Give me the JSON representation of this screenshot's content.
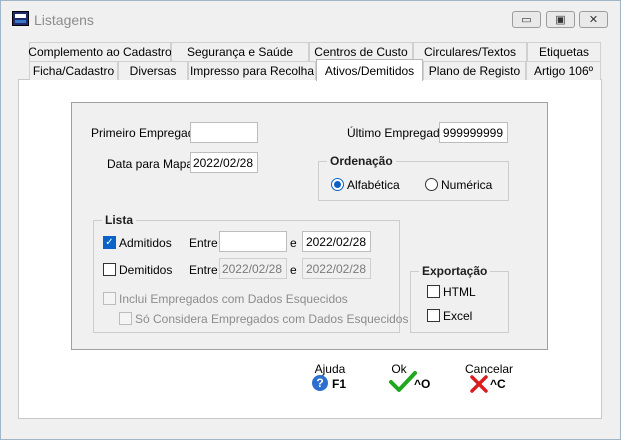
{
  "window": {
    "title": "Listagens",
    "minimize_glyph": "▭",
    "maximize_glyph": "▣",
    "close_glyph": "✕"
  },
  "tabs_row1": [
    "Complemento ao Cadastro",
    "Segurança e Saúde",
    "Centros de Custo",
    "Circulares/Textos",
    "Etiquetas"
  ],
  "tabs_row2": [
    "Ficha/Cadastro",
    "Diversas",
    "Impresso para Recolha",
    "Ativos/Demitidos",
    "Plano de Registo",
    "Artigo 106º"
  ],
  "active_tab": "Ativos/Demitidos",
  "form": {
    "primeiro_empregado_label": "Primeiro Empregado",
    "primeiro_empregado_value": "",
    "ultimo_empregado_label": "Último Empregado",
    "ultimo_empregado_value": "999999999",
    "data_mapa_label": "Data para Mapa",
    "data_mapa_value": "2022/02/28"
  },
  "ordenacao": {
    "title": "Ordenação",
    "options": [
      "Alfabética",
      "Numérica"
    ],
    "selected": "Alfabética"
  },
  "lista": {
    "title": "Lista",
    "admitidos_label": "Admitidos",
    "admitidos_checked": true,
    "demitidos_label": "Demitidos",
    "demitidos_checked": false,
    "entre_label": "Entre",
    "e_label": "e",
    "admitidos_from": "",
    "admitidos_to": "2022/02/28",
    "demitidos_from": "2022/02/28",
    "demitidos_to": "2022/02/28",
    "inclui_label": "Inclui Empregados com Dados Esquecidos",
    "so_considera_label": "Só Considera Empregados com Dados Esquecidos"
  },
  "exportacao": {
    "title": "Exportação",
    "html_label": "HTML",
    "excel_label": "Excel"
  },
  "actions": {
    "ajuda_label": "Ajuda",
    "ajuda_key": "F1",
    "ok_label": "Ok",
    "ok_key": "^O",
    "cancelar_label": "Cancelar",
    "cancelar_key": "^C"
  },
  "colors": {
    "accent": "#0a64c8",
    "ok_green": "#1fa81f",
    "cancel_red": "#d81e1e"
  }
}
